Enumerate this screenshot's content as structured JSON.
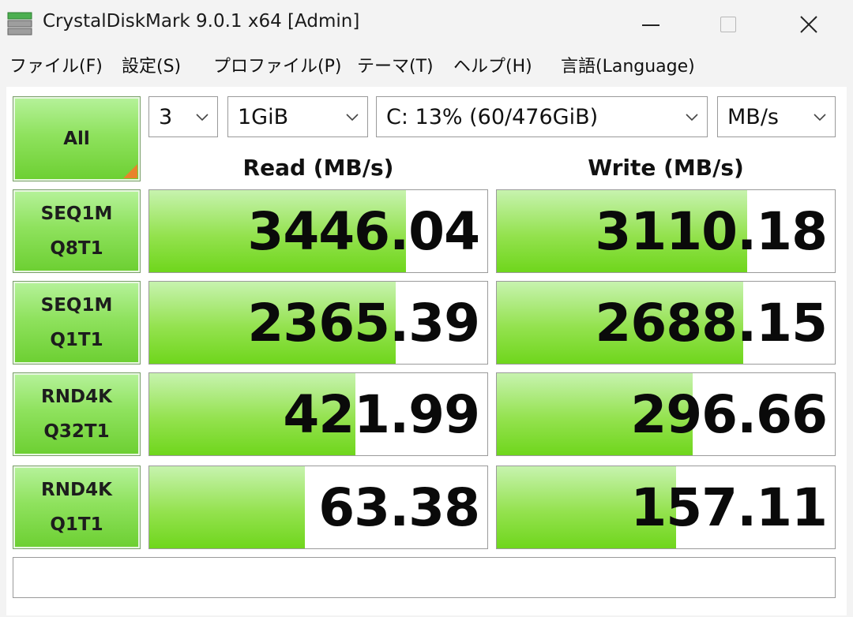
{
  "window": {
    "title": "CrystalDiskMark 9.0.1 x64 [Admin]"
  },
  "menu": [
    {
      "key": "file",
      "label": "ファイル(F)"
    },
    {
      "key": "settings",
      "label": "設定(S)"
    },
    {
      "key": "profile",
      "label": "プロファイル(P)"
    },
    {
      "key": "theme",
      "label": "テーマ(T)"
    },
    {
      "key": "help",
      "label": "ヘルプ(H)"
    },
    {
      "key": "language",
      "label": "言語(Language)"
    }
  ],
  "controls": {
    "all_label": "All",
    "count": "3",
    "size": "1GiB",
    "drive": "C: 13% (60/476GiB)",
    "unit": "MB/s"
  },
  "headers": {
    "read": "Read (MB/s)",
    "write": "Write (MB/s)"
  },
  "tests": [
    {
      "line1": "SEQ1M",
      "line2": "Q8T1",
      "read": "3446.04",
      "write": "3110.18",
      "read_fill": 0.76,
      "write_fill": 0.74
    },
    {
      "line1": "SEQ1M",
      "line2": "Q1T1",
      "read": "2365.39",
      "write": "2688.15",
      "read_fill": 0.73,
      "write_fill": 0.73
    },
    {
      "line1": "RND4K",
      "line2": "Q32T1",
      "read": "421.99",
      "write": "296.66",
      "read_fill": 0.61,
      "write_fill": 0.58
    },
    {
      "line1": "RND4K",
      "line2": "Q1T1",
      "read": "63.38",
      "write": "157.11",
      "read_fill": 0.46,
      "write_fill": 0.53
    }
  ],
  "status_text": "",
  "colors": {
    "accent_green": "#6fd61c",
    "corner_orange": "#e8832c"
  }
}
